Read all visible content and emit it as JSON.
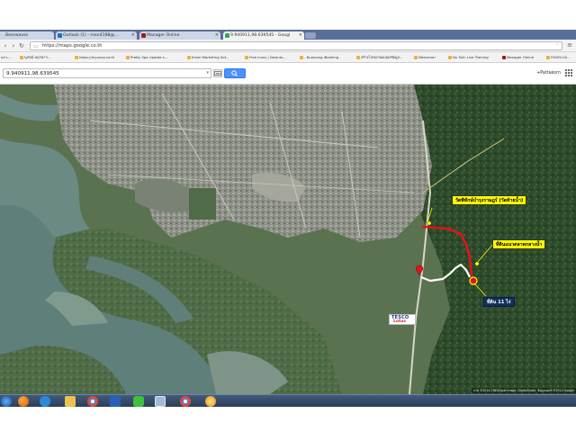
{
  "browser": {
    "tabs": [
      {
        "label": "Beerwaves",
        "active": false
      },
      {
        "label": "Outlook (1) - men4198@...",
        "active": false
      },
      {
        "label": "Manager Online",
        "active": false
      },
      {
        "label": "9.940911,98.639545 - Googl",
        "active": true
      }
    ],
    "address": {
      "url": "https://maps.google.co.th"
    },
    "bookmarks": [
      "ed L...",
      "นุสรณ์ พฤกษาฯ...",
      "https://my.sony.co.th",
      "Pretty Spa Update s...",
      "Email Marketing Sof...",
      "Free Icons | Downlo...",
      "- Bualuang iBanking -",
      "สร้างโปรแกรมแปลงข้อมูล...",
      "Welcome!",
      "Nu Skin Live Training",
      "Manager Online",
      "กรอบระบบ..."
    ]
  },
  "maps": {
    "search_value": "9.940911,98.639545",
    "user_label": "+Pattakorn"
  },
  "map_labels": {
    "temple_label": "วัดพิทักษ์บำรุงราษฎร์ (วัดท้ายน้ำ)",
    "office_label": "ที่ดินแนวตลาดกลางน้ำ",
    "land_label": "ที่ดิน 11 ไร่",
    "tesco_top": "TESCO",
    "tesco_bottom": "Lotus",
    "attribution": "ภาพ ©2014 CNES/Spot Image, DigitalGlobe, ข้อมูลแผนที่ ©2014 Google"
  },
  "colors": {
    "route_red": "#e0141b",
    "route_white": "#ffffff",
    "label_yellow": "#fffa00",
    "label_blue": "#10305e",
    "search_button": "#4d90fe"
  },
  "taskbar": {
    "icons": [
      "start-icon",
      "firefox-icon",
      "ie-icon",
      "explorer-icon",
      "chrome-icon",
      "word-icon",
      "line-icon",
      "app-icon",
      "chrome-2-icon",
      "paint-icon"
    ],
    "tray_text": ""
  }
}
